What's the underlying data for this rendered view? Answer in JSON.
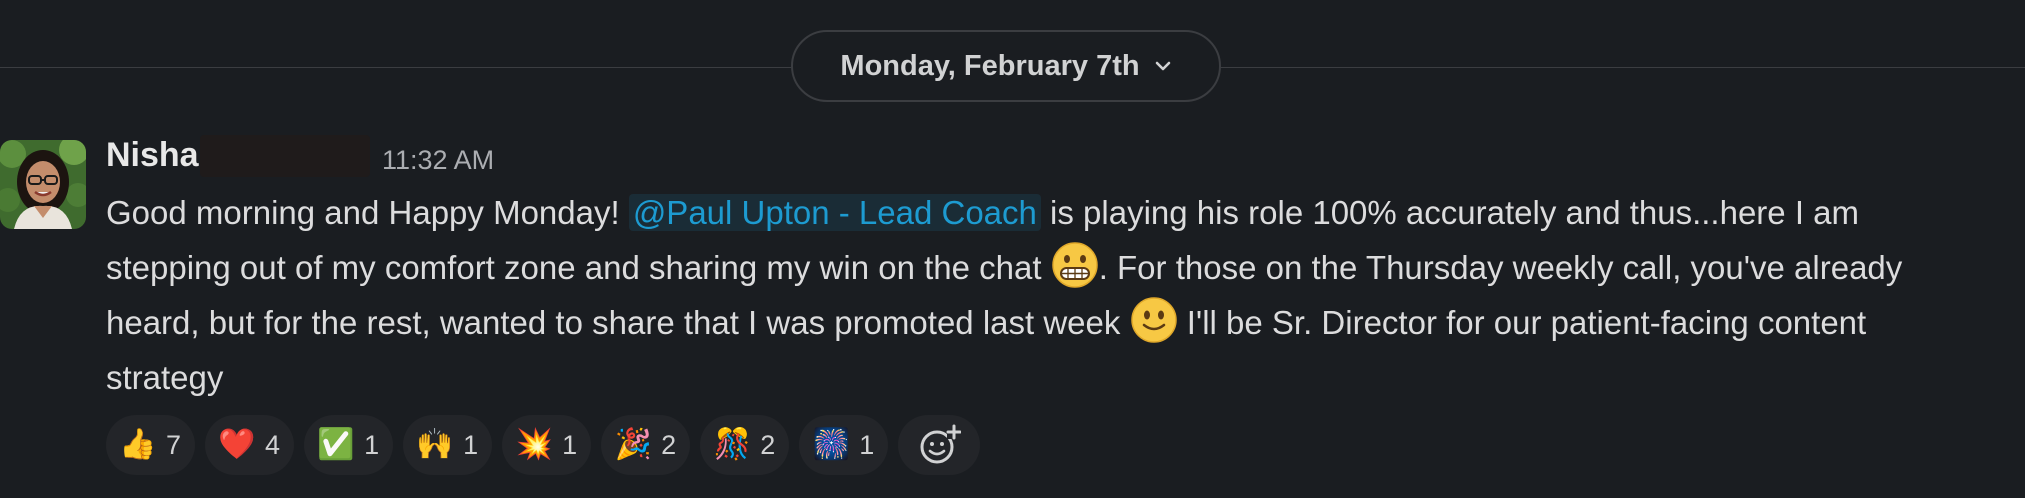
{
  "date_divider": {
    "label": "Monday, February 7th",
    "icon": "chevron-down-icon"
  },
  "message": {
    "author": "Nisha",
    "timestamp": "11:32 AM",
    "text_part1": "Good morning and Happy Monday! ",
    "mention": "@Paul Upton - Lead Coach",
    "text_part2": " is playing his role 100% accurately and thus...here I am stepping out of my comfort zone and sharing my win on the chat ",
    "emoji_1": "grimacing-face",
    "text_part3": ". For those on the Thursday weekly call, you've already heard, but for the rest, wanted to share that I was promoted last week ",
    "emoji_2": "slightly-smiling-face",
    "text_part4": "  I'll be Sr. Director for our patient-facing content strategy"
  },
  "reactions": [
    {
      "emoji": "👍",
      "name": "thumbs-up",
      "count": "7"
    },
    {
      "emoji": "❤️",
      "name": "red-heart",
      "count": "4"
    },
    {
      "emoji": "✅",
      "name": "check-mark",
      "count": "1"
    },
    {
      "emoji": "🙌",
      "name": "raised-hands",
      "count": "1"
    },
    {
      "emoji": "💥",
      "name": "collision",
      "count": "1"
    },
    {
      "emoji": "🎉",
      "name": "party-popper",
      "count": "2"
    },
    {
      "emoji": "🎊",
      "name": "confetti-ball",
      "count": "2"
    },
    {
      "emoji": "🎆",
      "name": "fireworks",
      "count": "1"
    }
  ],
  "add_reaction_icon": "add-reaction-icon",
  "colors": {
    "background": "#1a1d21",
    "mention": "#1d9bd1",
    "reaction_bg": "#232529"
  }
}
